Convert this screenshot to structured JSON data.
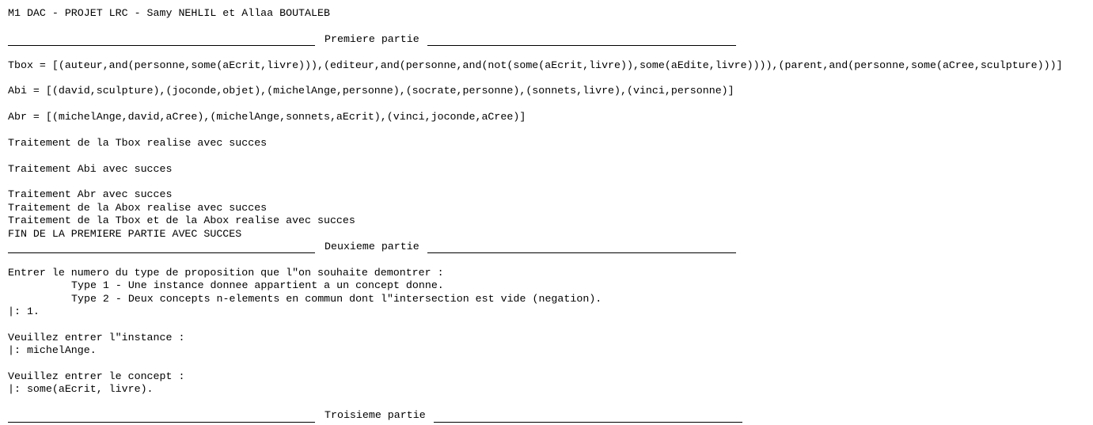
{
  "header": {
    "title": "M1 DAC - PROJET LRC - Samy NEHLIL et Allaa BOUTALEB"
  },
  "sections": {
    "part1": "Premiere partie",
    "part2": "Deuxieme partie",
    "part3": "Troisieme partie"
  },
  "output": {
    "tbox": "Tbox = [(auteur,and(personne,some(aEcrit,livre))),(editeur,and(personne,and(not(some(aEcrit,livre)),some(aEdite,livre)))),(parent,and(personne,some(aCree,sculpture)))]",
    "abi": "Abi = [(david,sculpture),(joconde,objet),(michelAnge,personne),(socrate,personne),(sonnets,livre),(vinci,personne)]",
    "abr": "Abr = [(michelAnge,david,aCree),(michelAnge,sonnets,aEcrit),(vinci,joconde,aCree)]",
    "msg_tbox": "Traitement de la Tbox realise avec succes",
    "msg_abi": "Traitement Abi avec succes",
    "msg_abr": "Traitement Abr avec succes",
    "msg_abox": "Traitement de la Abox realise avec succes",
    "msg_tbox_abox": "Traitement de la Tbox et de la Abox realise avec succes",
    "msg_fin": "FIN DE LA PREMIERE PARTIE AVEC SUCCES"
  },
  "prompts": {
    "type_question": "Entrer le numero du type de proposition que l\"on souhaite demontrer :",
    "type1": "Type 1 - Une instance donnee appartient a un concept donne.",
    "type2": "Type 2 - Deux concepts n-elements en commun dont l\"intersection est vide (negation).",
    "type_input": "|: 1.",
    "instance_question": "Veuillez entrer l\"instance :",
    "instance_input": "|: michelAnge.",
    "concept_question": "Veuillez entrer le concept :",
    "concept_input": "|: some(aEcrit, livre)."
  }
}
